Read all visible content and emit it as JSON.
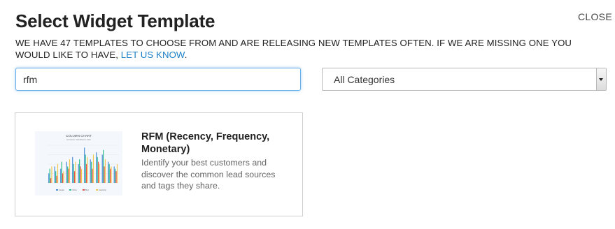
{
  "header": {
    "title": "Select Widget Template",
    "close_label": "CLOSE",
    "subtitle_text": "WE HAVE 47 TEMPLATES TO CHOOSE FROM AND ARE RELEASING NEW TEMPLATES OFTEN. IF WE ARE MISSING ONE YOU WOULD LIKE TO HAVE, ",
    "subtitle_link": "LET US KNOW",
    "subtitle_end": "."
  },
  "filters": {
    "search_value": "rfm",
    "category_selected": "All Categories"
  },
  "templates": [
    {
      "title": "RFM (Recency, Frequency, Monetary)",
      "description": "Identify your best customers and discover the common lead sources and tags they share.",
      "thumbnail": {
        "chart_title": "COLUMN CHART",
        "chart_subtitle": "SOURCE: WIKIPEDIA.ORG",
        "legend": [
          "Google",
          "Yahoo",
          "Bing",
          "Facebook"
        ],
        "series_colors": [
          "#4a8fd8",
          "#2fbf8f",
          "#e94f4f",
          "#f2c94c"
        ],
        "values": [
          [
            20,
            30,
            10,
            35
          ],
          [
            35,
            25,
            15,
            40
          ],
          [
            30,
            45,
            20,
            25
          ],
          [
            45,
            35,
            30,
            50
          ],
          [
            55,
            40,
            25,
            45
          ],
          [
            40,
            50,
            35,
            30
          ],
          [
            75,
            60,
            40,
            55
          ],
          [
            50,
            45,
            30,
            60
          ],
          [
            65,
            55,
            45,
            40
          ],
          [
            60,
            70,
            35,
            50
          ],
          [
            45,
            40,
            30,
            35
          ],
          [
            35,
            30,
            25,
            40
          ]
        ]
      }
    }
  ]
}
